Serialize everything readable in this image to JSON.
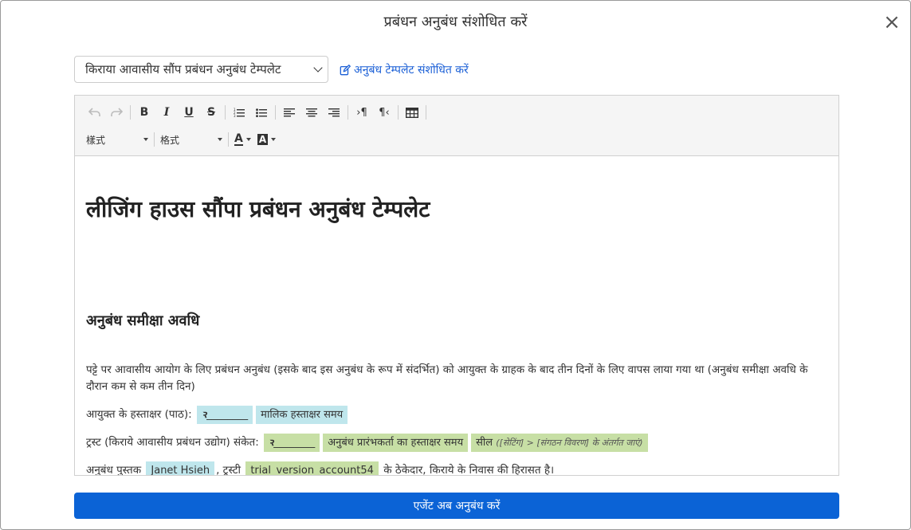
{
  "modal": {
    "title": "प्रबंधन अनुबंध संशोधित करें",
    "close_label": "×"
  },
  "template_select": {
    "value": "किराया आवासीय सौंप प्रबंधन अनुबंध टेम्पलेट"
  },
  "edit_template_link": "अनुबंध टेम्पलेट संशोधित करें",
  "toolbar": {
    "style_dropdown": "樣式",
    "format_dropdown": "格式",
    "font_color_label": "A",
    "bg_color_label": "A"
  },
  "document": {
    "heading": "लीजिंग हाउस सौंपा प्रबंधन अनुबंध टेम्पलेट",
    "section_heading": "अनुबंध समीक्षा अवधि",
    "paragraph1": "पट्टे पर आवासीय आयोग के लिए प्रबंधन अनुबंध (इसके बाद इस अनुबंध के रूप में संदर्भित) को आयुक्त के ग्राहक के बाद तीन दिनों के लिए वापस लाया गया था (अनुबंध समीक्षा अवधि के दौरान कम से कम तीन दिन)",
    "line2": {
      "label": "आयुक्त के हस्ताक्षर (पाठ):",
      "sig_blank": "________",
      "chip_time": "मालिक हस्ताक्षर समय"
    },
    "line3": {
      "label": "ट्रस्ट (किराये आवासीय प्रबंधन उद्योग) संकेत:",
      "sig_blank": "________",
      "chip_time": "अनुबंध प्रारंभकर्ता का हस्ताक्षर समय",
      "chip_seal": "सील",
      "chip_seal_note": "([सेटिंग] > [संगठन विवरण] के अंतर्गत जाएं)"
    },
    "line4": {
      "prefix": "अनुबंध पुस्तक",
      "chip_name": "Janet Hsieh",
      "middle": ", ट्रस्टी",
      "chip_account": "trial_version_account54",
      "suffix": "के ठेकेदार, किराये के निवास की हिरासत है।"
    }
  },
  "submit_button": "एजेंट अब अनुबंध करें"
}
